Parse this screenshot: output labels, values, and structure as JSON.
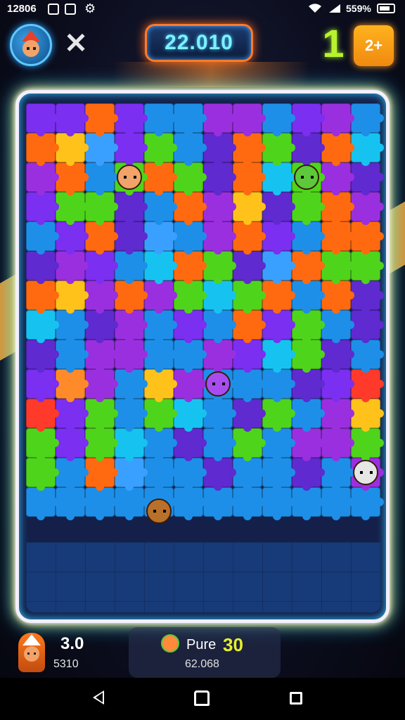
{
  "status": {
    "time": "12806",
    "battery": "559%"
  },
  "header": {
    "score": "22.010",
    "level": "1",
    "badge": "2+"
  },
  "footer": {
    "player_score": "3.0",
    "player_sub": "5310",
    "label": "Pure",
    "center_score": "30",
    "center_sub": "62.068"
  },
  "colors": {
    "frame_glow": "#27c6ff",
    "frame_gold": "#ffd23a",
    "score_border": "#ff7a2a",
    "level_green": "#b8f22e",
    "badge_orange": "#f89a12",
    "palette": [
      "#7b2ff0",
      "#ff6a10",
      "#1e8fe8",
      "#4fd41c",
      "#ffc21a",
      "#16c3f0",
      "#9a2fe0",
      "#ff3a2a",
      "#2a6ff0",
      "#5f2ad0",
      "#2fb4ff",
      "#ff8a2a",
      "#3aa0ff",
      "#6f35e8",
      "#ff5a3a",
      "#12a8e8"
    ]
  },
  "board": {
    "rows": [
      [
        0,
        0,
        1,
        0,
        2,
        2,
        6,
        6,
        2,
        0,
        6,
        2
      ],
      [
        1,
        4,
        12,
        0,
        3,
        2,
        9,
        1,
        3,
        9,
        1,
        5
      ],
      [
        6,
        1,
        2,
        3,
        1,
        3,
        9,
        1,
        5,
        3,
        6,
        9
      ],
      [
        0,
        3,
        3,
        9,
        2,
        1,
        6,
        4,
        9,
        3,
        1,
        6
      ],
      [
        2,
        0,
        1,
        9,
        12,
        2,
        6,
        1,
        0,
        2,
        1,
        1
      ],
      [
        9,
        6,
        0,
        2,
        5,
        1,
        3,
        9,
        12,
        1,
        3,
        3
      ],
      [
        1,
        4,
        6,
        1,
        6,
        3,
        5,
        3,
        1,
        2,
        1,
        9
      ],
      [
        5,
        2,
        9,
        6,
        2,
        0,
        2,
        1,
        0,
        3,
        2,
        9
      ],
      [
        9,
        2,
        6,
        6,
        2,
        2,
        6,
        0,
        5,
        3,
        9,
        2
      ],
      [
        0,
        11,
        6,
        2,
        4,
        6,
        2,
        2,
        2,
        9,
        0,
        7
      ],
      [
        7,
        0,
        3,
        2,
        3,
        5,
        2,
        9,
        3,
        2,
        6,
        4
      ],
      [
        3,
        0,
        3,
        5,
        2,
        9,
        2,
        3,
        2,
        6,
        6,
        3
      ],
      [
        3,
        2,
        1,
        12,
        2,
        2,
        9,
        2,
        2,
        9,
        2,
        6
      ],
      [
        2,
        2,
        2,
        2,
        2,
        2,
        2,
        2,
        2,
        2,
        2,
        2
      ]
    ],
    "characters": [
      {
        "name": "brown-hair-girl",
        "row": 2,
        "col": 3
      },
      {
        "name": "green-goblin",
        "row": 2,
        "col": 9
      },
      {
        "name": "purple-ghost",
        "row": 9,
        "col": 6
      },
      {
        "name": "helmet-kid",
        "row": 12,
        "col": 11
      },
      {
        "name": "brown-hat-boy",
        "row": 14,
        "col": 4
      }
    ]
  }
}
